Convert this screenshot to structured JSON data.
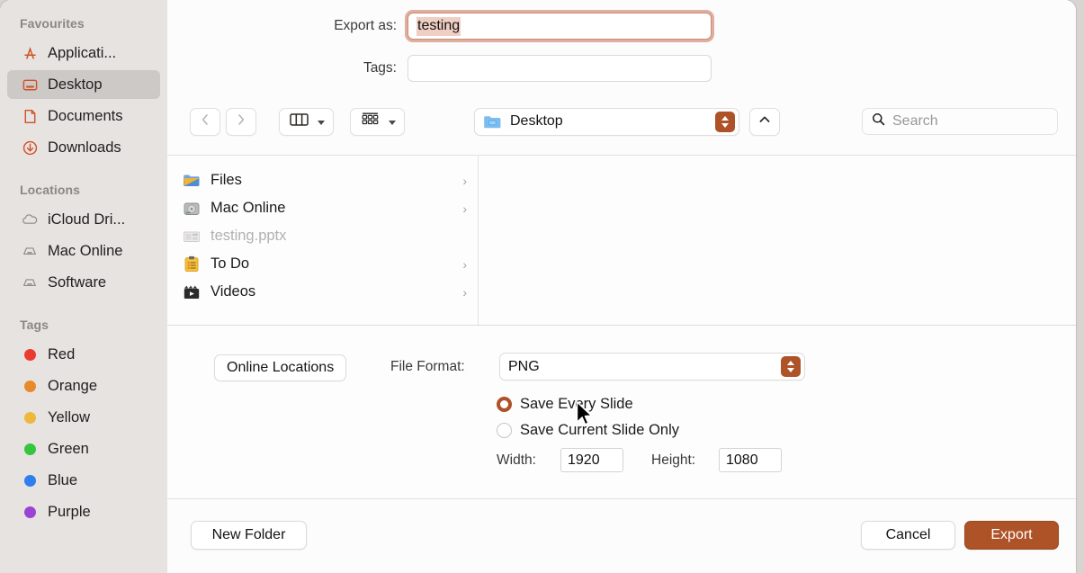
{
  "accent": {
    "rust": "#ae5227",
    "sidebar_icon": "#d0522a",
    "focus_ring": "#dfae9c",
    "selection": "#efcfc4"
  },
  "export_as": {
    "label": "Export as:",
    "value": "testing"
  },
  "tags_field": {
    "label": "Tags:",
    "value": "",
    "placeholder": ""
  },
  "toolbar": {
    "back_icon": "chevron-left-icon",
    "forward_icon": "chevron-right-icon",
    "view_icon": "column-view-icon",
    "group_icon": "group-by-icon",
    "location": "Desktop",
    "location_icon": "folder-icon",
    "up_icon": "chevron-up-icon",
    "search_placeholder": "Search",
    "search_value": "",
    "search_icon": "search-icon"
  },
  "sidebar": {
    "sections": [
      {
        "title": "Favourites",
        "items": [
          {
            "label": "Applicati...",
            "icon": "applications-icon",
            "selected": false
          },
          {
            "label": "Desktop",
            "icon": "desktop-icon",
            "selected": true
          },
          {
            "label": "Documents",
            "icon": "document-icon",
            "selected": false
          },
          {
            "label": "Downloads",
            "icon": "downloads-icon",
            "selected": false
          }
        ]
      },
      {
        "title": "Locations",
        "items": [
          {
            "label": "iCloud Dri...",
            "icon": "icloud-icon",
            "selected": false
          },
          {
            "label": "Mac Online",
            "icon": "disk-icon",
            "selected": false
          },
          {
            "label": "Software",
            "icon": "disk-icon",
            "selected": false
          }
        ]
      },
      {
        "title": "Tags",
        "items": [
          {
            "label": "Red",
            "icon": "tag-dot-icon",
            "color": "#eb3b30"
          },
          {
            "label": "Orange",
            "icon": "tag-dot-icon",
            "color": "#e8892a"
          },
          {
            "label": "Yellow",
            "icon": "tag-dot-icon",
            "color": "#edb93c"
          },
          {
            "label": "Green",
            "icon": "tag-dot-icon",
            "color": "#36c53f"
          },
          {
            "label": "Blue",
            "icon": "tag-dot-icon",
            "color": "#2e7ef0"
          },
          {
            "label": "Purple",
            "icon": "tag-dot-icon",
            "color": "#9b44d4"
          }
        ]
      }
    ]
  },
  "file_list": [
    {
      "label": "Files",
      "icon": "folder-icon",
      "dim": false,
      "has_disclosure": true
    },
    {
      "label": "Mac Online",
      "icon": "hard-drive-icon",
      "dim": false,
      "has_disclosure": true
    },
    {
      "label": "testing.pptx",
      "icon": "presentation-file-icon",
      "dim": true,
      "has_disclosure": false
    },
    {
      "label": "To Do",
      "icon": "clipboard-icon",
      "dim": false,
      "has_disclosure": true
    },
    {
      "label": "Videos",
      "icon": "clapperboard-icon",
      "dim": false,
      "has_disclosure": true
    }
  ],
  "options": {
    "online_locations_label": "Online Locations",
    "file_format_label": "File Format:",
    "file_format_value": "PNG",
    "radios": [
      {
        "label": "Save Every Slide",
        "selected": true
      },
      {
        "label": "Save Current Slide Only",
        "selected": false
      }
    ],
    "width_label": "Width:",
    "width_value": "1920",
    "height_label": "Height:",
    "height_value": "1080"
  },
  "footer": {
    "new_folder_label": "New Folder",
    "cancel_label": "Cancel",
    "export_label": "Export"
  }
}
